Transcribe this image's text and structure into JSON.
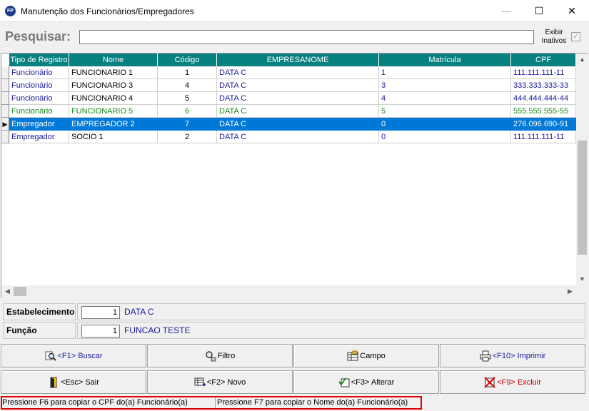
{
  "window": {
    "app_icon": "FP",
    "title": "Manutenção dos Funcionários/Empregadores",
    "minimize": "—",
    "maximize": "☐",
    "close": "✕"
  },
  "search": {
    "label": "Pesquisar:",
    "value": "",
    "show_inactive_line1": "Exibir",
    "show_inactive_line2": "Inativos",
    "show_inactive_checked": true,
    "check_mark": "✓"
  },
  "grid": {
    "columns": [
      "Tipo de Registro",
      "Nome",
      "Código",
      "EMPRESANOME",
      "Matrícula",
      "CPF"
    ],
    "rows": [
      {
        "tipo": "Funcionário",
        "nome": "FUNCIONARIO 1",
        "codigo": "1",
        "empresa": "DATA C",
        "matricula": "1",
        "cpf": "111.111.111-11",
        "color": "#1b1b9e"
      },
      {
        "tipo": "Funcionário",
        "nome": "FUNCIONARIO 3",
        "codigo": "4",
        "empresa": "DATA C",
        "matricula": "3",
        "cpf": "333.333.333-33",
        "color": "#1b1b9e"
      },
      {
        "tipo": "Funcionário",
        "nome": "FUNCIONARIO 4",
        "codigo": "5",
        "empresa": "DATA C",
        "matricula": "4",
        "cpf": "444.444.444-44",
        "color": "#1b1b9e"
      },
      {
        "tipo": "Funcionário",
        "nome": "FUNCIONARIO 5",
        "codigo": "6",
        "empresa": "DATA C",
        "matricula": "5",
        "cpf": "555.555.555-55",
        "color": "#1a8a1a"
      },
      {
        "tipo": "Empregador",
        "nome": "EMPREGADOR 2",
        "codigo": "7",
        "empresa": "DATA C",
        "matricula": "0",
        "cpf": "276.096.690-91",
        "color": "#1b1b9e",
        "selected": true
      },
      {
        "tipo": "Empregador",
        "nome": "SOCIO 1",
        "codigo": "2",
        "empresa": "DATA C",
        "matricula": "0",
        "cpf": "111.111.111-11",
        "color": "#1b1b9e"
      }
    ],
    "current_row_marker": "▶",
    "scroll_up": "▲",
    "scroll_down": "▼",
    "scroll_left": "◀",
    "scroll_right": "▶"
  },
  "info": {
    "estabelecimento_label": "Estabelecimento",
    "estabelecimento_code": "1",
    "estabelecimento_name": "DATA C",
    "funcao_label": "Função",
    "funcao_code": "1",
    "funcao_name": "FUNCAO TESTE"
  },
  "buttons": {
    "buscar": "<F1> Buscar",
    "filtro": "Filtro",
    "campo": "Campo",
    "imprimir": "<F10> Imprimir",
    "sair": "<Esc> Sair",
    "novo": "<F2> Novo",
    "alterar": "<F3> Alterar",
    "excluir": "<F9> Excluir"
  },
  "status": {
    "pane1": "Pressione F6 para copiar o CPF do(a) Funcionário(a)",
    "pane2": "Pressione F7 para copiar o Nome do(a) Funcionário(a)"
  },
  "colors": {
    "header_bg": "#078080",
    "selection": "#0078d7",
    "link_blue": "#1b1b9e",
    "green_row": "#1a8a1a",
    "status_highlight": "#e00000"
  }
}
